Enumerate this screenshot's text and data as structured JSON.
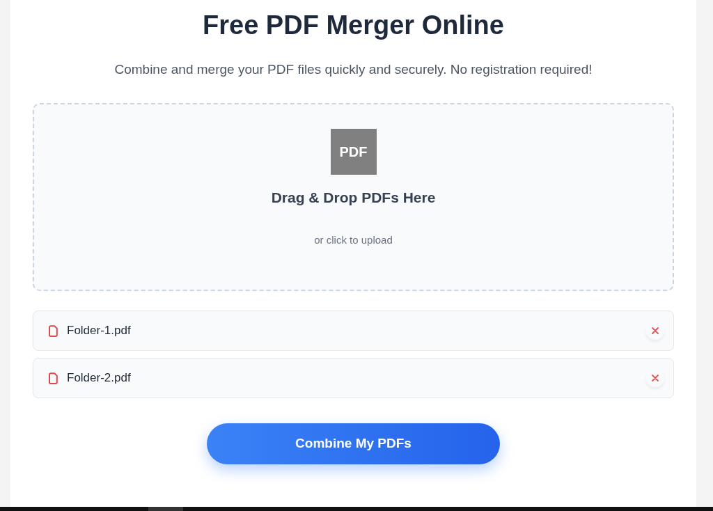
{
  "header": {
    "title": "Free PDF Merger Online",
    "subtitle": "Combine and merge your PDF files quickly and securely. No registration required!"
  },
  "drop_zone": {
    "icon_text": "PDF",
    "heading": "Drag & Drop PDFs Here",
    "hint": "or click to upload"
  },
  "files": [
    {
      "name": "Folder-1.pdf"
    },
    {
      "name": "Folder-2.pdf"
    }
  ],
  "primary_button": {
    "label": "Combine My PDFs"
  }
}
